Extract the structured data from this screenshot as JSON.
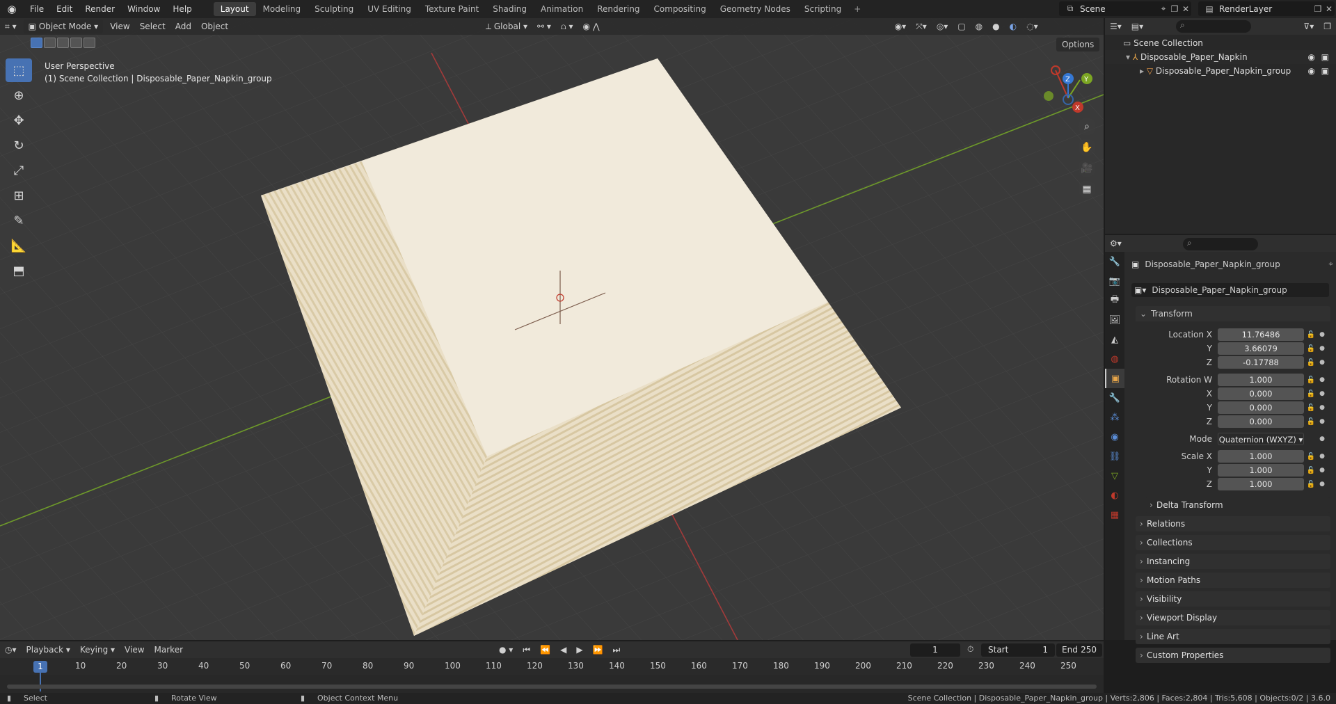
{
  "app": {
    "menus": [
      "File",
      "Edit",
      "Render",
      "Window",
      "Help"
    ],
    "workspaces": [
      "Layout",
      "Modeling",
      "Sculpting",
      "UV Editing",
      "Texture Paint",
      "Shading",
      "Animation",
      "Rendering",
      "Compositing",
      "Geometry Nodes",
      "Scripting"
    ],
    "active_workspace": "Layout",
    "scene": "Scene",
    "render_layer": "RenderLayer"
  },
  "viewport": {
    "mode": "Object Mode",
    "menus": [
      "View",
      "Select",
      "Add",
      "Object"
    ],
    "orientation": "Global",
    "options_label": "Options",
    "view_name": "User Perspective",
    "view_context": "(1) Scene Collection | Disposable_Paper_Napkin_group"
  },
  "outliner": {
    "root": "Scene Collection",
    "items": [
      {
        "name": "Disposable_Paper_Napkin"
      },
      {
        "name": "Disposable_Paper_Napkin_group"
      }
    ]
  },
  "properties": {
    "object_name": "Disposable_Paper_Napkin_group",
    "datablock_name": "Disposable_Paper_Napkin_group",
    "transform_label": "Transform",
    "location": {
      "label": "Location X",
      "x": "11.76486",
      "y": "3.66079",
      "z": "-0.17788"
    },
    "rotation": {
      "label": "Rotation W",
      "w": "1.000",
      "x": "0.000",
      "y": "0.000",
      "z": "0.000"
    },
    "mode": {
      "label": "Mode",
      "value": "Quaternion (WXYZ)"
    },
    "scale": {
      "label": "Scale X",
      "x": "1.000",
      "y": "1.000",
      "z": "1.000"
    },
    "axis_labels": {
      "x": "X",
      "y": "Y",
      "z": "Z"
    },
    "delta_transform": "Delta Transform",
    "panels": [
      "Relations",
      "Collections",
      "Instancing",
      "Motion Paths",
      "Visibility",
      "Viewport Display",
      "Line Art",
      "Custom Properties"
    ]
  },
  "timeline": {
    "menus": [
      "Playback",
      "Keying",
      "View",
      "Marker"
    ],
    "current_frame": "1",
    "start_label": "Start",
    "start": "1",
    "end_label": "End",
    "end": "250",
    "ticks": [
      "10",
      "20",
      "30",
      "40",
      "50",
      "60",
      "70",
      "80",
      "90",
      "100",
      "110",
      "120",
      "130",
      "140",
      "150",
      "160",
      "170",
      "180",
      "190",
      "200",
      "210",
      "220",
      "230",
      "240",
      "250"
    ]
  },
  "statusbar": {
    "hint_select": "Select",
    "hint_rotate": "Rotate View",
    "hint_context": "Object Context Menu",
    "stats": "Scene Collection | Disposable_Paper_Napkin_group | Verts:2,806 | Faces:2,804 | Tris:5,608 | Objects:0/2 | 3.6.0"
  },
  "colors": {
    "accent": "#4772b3",
    "napkin": "#efe7d6",
    "grid_x": "#b03a3a",
    "grid_y": "#6e9a2a"
  }
}
